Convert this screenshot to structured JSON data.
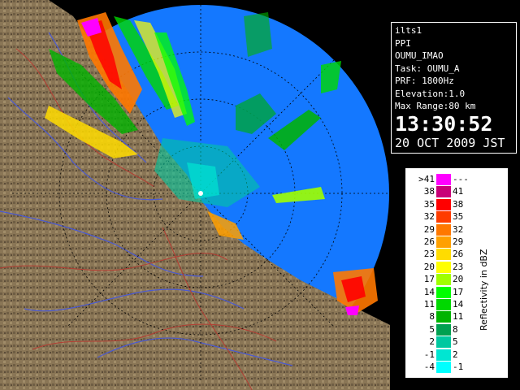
{
  "info": {
    "station": "ilts1",
    "product": "PPI",
    "site": "OUMU_IMAO",
    "task": "Task: OUMU_A",
    "prf": "PRF: 1800Hz",
    "elevation": "Elevation:1.0",
    "max_range": "Max Range:80 km",
    "time": "13:30:52",
    "date": "20 OCT 2009 JST"
  },
  "legend": {
    "title": "Reflectivity in dBZ",
    "rows": [
      {
        "min": ">41",
        "max": "---",
        "color": "#ff00ff"
      },
      {
        "min": "38",
        "max": "41",
        "color": "#c80078"
      },
      {
        "min": "35",
        "max": "38",
        "color": "#ff0000"
      },
      {
        "min": "32",
        "max": "35",
        "color": "#ff3c00"
      },
      {
        "min": "29",
        "max": "32",
        "color": "#ff7800"
      },
      {
        "min": "26",
        "max": "29",
        "color": "#ffa000"
      },
      {
        "min": "23",
        "max": "26",
        "color": "#ffdc00"
      },
      {
        "min": "20",
        "max": "23",
        "color": "#ffff00"
      },
      {
        "min": "17",
        "max": "20",
        "color": "#a0ff00"
      },
      {
        "min": "14",
        "max": "17",
        "color": "#00ff00"
      },
      {
        "min": "11",
        "max": "14",
        "color": "#00d800"
      },
      {
        "min": "8",
        "max": "11",
        "color": "#00b400"
      },
      {
        "min": "5",
        "max": "8",
        "color": "#00a050"
      },
      {
        "min": "2",
        "max": "5",
        "color": "#00c8a0"
      },
      {
        "min": "-1",
        "max": "2",
        "color": "#00e6d2"
      },
      {
        "min": "-4",
        "max": "-1",
        "color": "#00ffff"
      }
    ]
  },
  "colors": {
    "range_disk": "#1478ff",
    "terrain": "#8a7656",
    "coast": "#5a4f3f",
    "rivers": "#4b5ad2",
    "borders": "#b43c32"
  },
  "icons": [
    "radar-center-icon"
  ]
}
